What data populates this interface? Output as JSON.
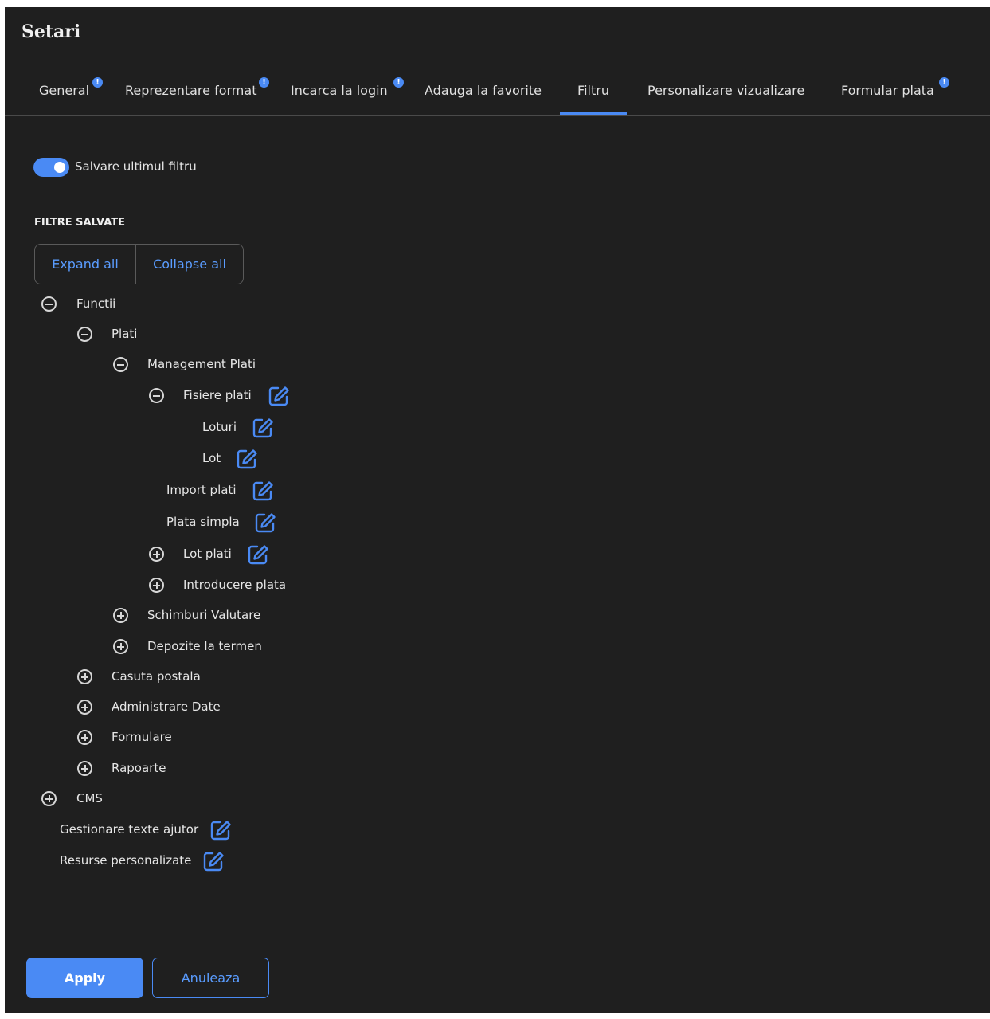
{
  "dialog": {
    "title": "Setari"
  },
  "tabs": [
    {
      "label": "General",
      "badge": "!"
    },
    {
      "label": "Reprezentare format",
      "badge": "!"
    },
    {
      "label": "Incarca la login",
      "badge": "!"
    },
    {
      "label": "Adauga la favorite"
    },
    {
      "label": "Filtru",
      "active": true
    },
    {
      "label": "Personalizare vizualizare"
    },
    {
      "label": "Formular plata",
      "badge": "!"
    }
  ],
  "toggle": {
    "label": "Salvare ultimul filtru",
    "checked": true
  },
  "saved_filters": {
    "title": "FILTRE SALVATE",
    "expand_label": "Expand all",
    "collapse_label": "Collapse all"
  },
  "tree": [
    {
      "label": "Functii",
      "toggle": "minus"
    },
    {
      "label": "Plati",
      "toggle": "minus"
    },
    {
      "label": "Management Plati",
      "toggle": "minus"
    },
    {
      "label": "Fisiere plati",
      "toggle": "minus",
      "editable": true
    },
    {
      "label": "Loturi",
      "editable": true
    },
    {
      "label": "Lot",
      "editable": true
    },
    {
      "label": "Import plati",
      "editable": true
    },
    {
      "label": "Plata simpla",
      "editable": true
    },
    {
      "label": "Lot plati",
      "toggle": "plus",
      "editable": true
    },
    {
      "label": "Introducere plata",
      "toggle": "plus"
    },
    {
      "label": "Schimburi Valutare",
      "toggle": "plus"
    },
    {
      "label": "Depozite la termen",
      "toggle": "plus"
    },
    {
      "label": "Casuta postala",
      "toggle": "plus"
    },
    {
      "label": "Administrare Date",
      "toggle": "plus"
    },
    {
      "label": "Formulare",
      "toggle": "plus"
    },
    {
      "label": "Rapoarte",
      "toggle": "plus"
    },
    {
      "label": "CMS",
      "toggle": "plus"
    },
    {
      "label": "Gestionare texte ajutor",
      "editable": true
    },
    {
      "label": "Resurse personalizate",
      "editable": true
    }
  ],
  "footer": {
    "apply_label": "Apply",
    "cancel_label": "Anuleaza"
  },
  "colors": {
    "accent": "#4a8af4",
    "background": "#1f1f1f",
    "text": "#e6e6e6"
  }
}
